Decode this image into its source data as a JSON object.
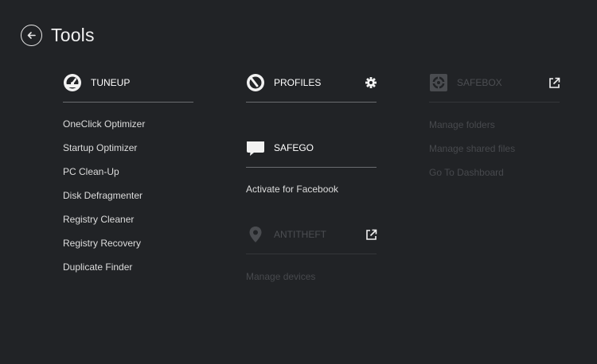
{
  "header": {
    "title": "Tools"
  },
  "tuneup": {
    "label": "TUNEUP",
    "items": [
      "OneClick Optimizer",
      "Startup Optimizer",
      "PC Clean-Up",
      "Disk Defragmenter",
      "Registry Cleaner",
      "Registry Recovery",
      "Duplicate Finder"
    ]
  },
  "profiles": {
    "label": "PROFILES"
  },
  "safego": {
    "label": "SAFEGO",
    "items": [
      "Activate for Facebook"
    ]
  },
  "antitheft": {
    "label": "ANTITHEFT",
    "items": [
      "Manage devices"
    ]
  },
  "safebox": {
    "label": "SAFEBOX",
    "items": [
      "Manage folders",
      "Manage shared files",
      "Go To Dashboard"
    ]
  },
  "colors": {
    "background": "#212326",
    "text": "#dcdcdc",
    "disabled_text": "#47494d",
    "rule": "#6a6c70"
  }
}
